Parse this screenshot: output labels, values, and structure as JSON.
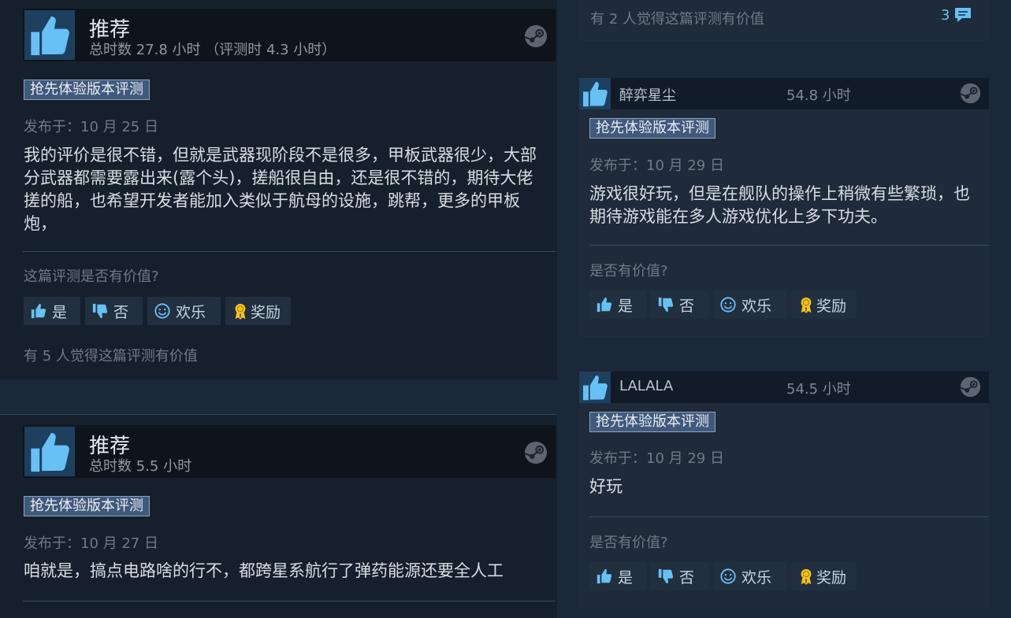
{
  "left_reviews": [
    {
      "recommendation": "推荐",
      "hours": "总时数 27.8 小时 （评测时 4.3 小时）",
      "badge": "抢先体验版本评测",
      "posted": "发布于：10 月 25 日",
      "text": "我的评价是很不错，但就是武器现阶段不是很多，甲板武器很少，大部分武器都需要露出来(露个头)，搓船很自由，还是很不错的，期待大佬搓的船，也希望开发者能加入类似于航母的设施，跳帮，更多的甲板炮，",
      "helpful_question": "这篇评测是否有价值?",
      "buttons": {
        "yes": "是",
        "no": "否",
        "funny": "欢乐",
        "award": "奖励"
      },
      "helpful_count": "有 5 人觉得这篇评测有价值"
    },
    {
      "recommendation": "推荐",
      "hours": "总时数 5.5 小时",
      "badge": "抢先体验版本评测",
      "posted": "发布于：10 月 27 日",
      "text": "咱就是，搞点电路啥的行不，都跨星系航行了弹药能源还要全人工"
    }
  ],
  "right_top": {
    "helpful_count": "有 2 人觉得这篇评测有价值",
    "comment_count": "3"
  },
  "right_reviews": [
    {
      "name": "醉弈星尘",
      "hours": "54.8 小时",
      "badge": "抢先体验版本评测",
      "posted": "发布于：10 月 29 日",
      "text": "游戏很好玩，但是在舰队的操作上稍微有些繁琐，也期待游戏能在多人游戏优化上多下功夫。",
      "helpful_question": "是否有价值?",
      "buttons": {
        "yes": "是",
        "no": "否",
        "funny": "欢乐",
        "award": "奖励"
      }
    },
    {
      "name": "LALALA",
      "hours": "54.5 小时",
      "badge": "抢先体验版本评测",
      "posted": "发布于：10 月 29 日",
      "text": "好玩",
      "helpful_question": "是否有价值?",
      "buttons": {
        "yes": "是",
        "no": "否",
        "funny": "欢乐",
        "award": "奖励"
      }
    }
  ],
  "colors": {
    "page_bg": "#1b2838",
    "card_bg": "#16202d",
    "header_bg": "#0e141b",
    "badge_bg": "#41597a",
    "accent_blue": "#66c0f4",
    "award_gold": "#f5c518"
  },
  "icons": [
    "thumbs-up-icon",
    "thumbs-down-icon",
    "smiley-icon",
    "award-ribbon-icon",
    "steam-logo-icon",
    "comment-bubble-icon"
  ]
}
